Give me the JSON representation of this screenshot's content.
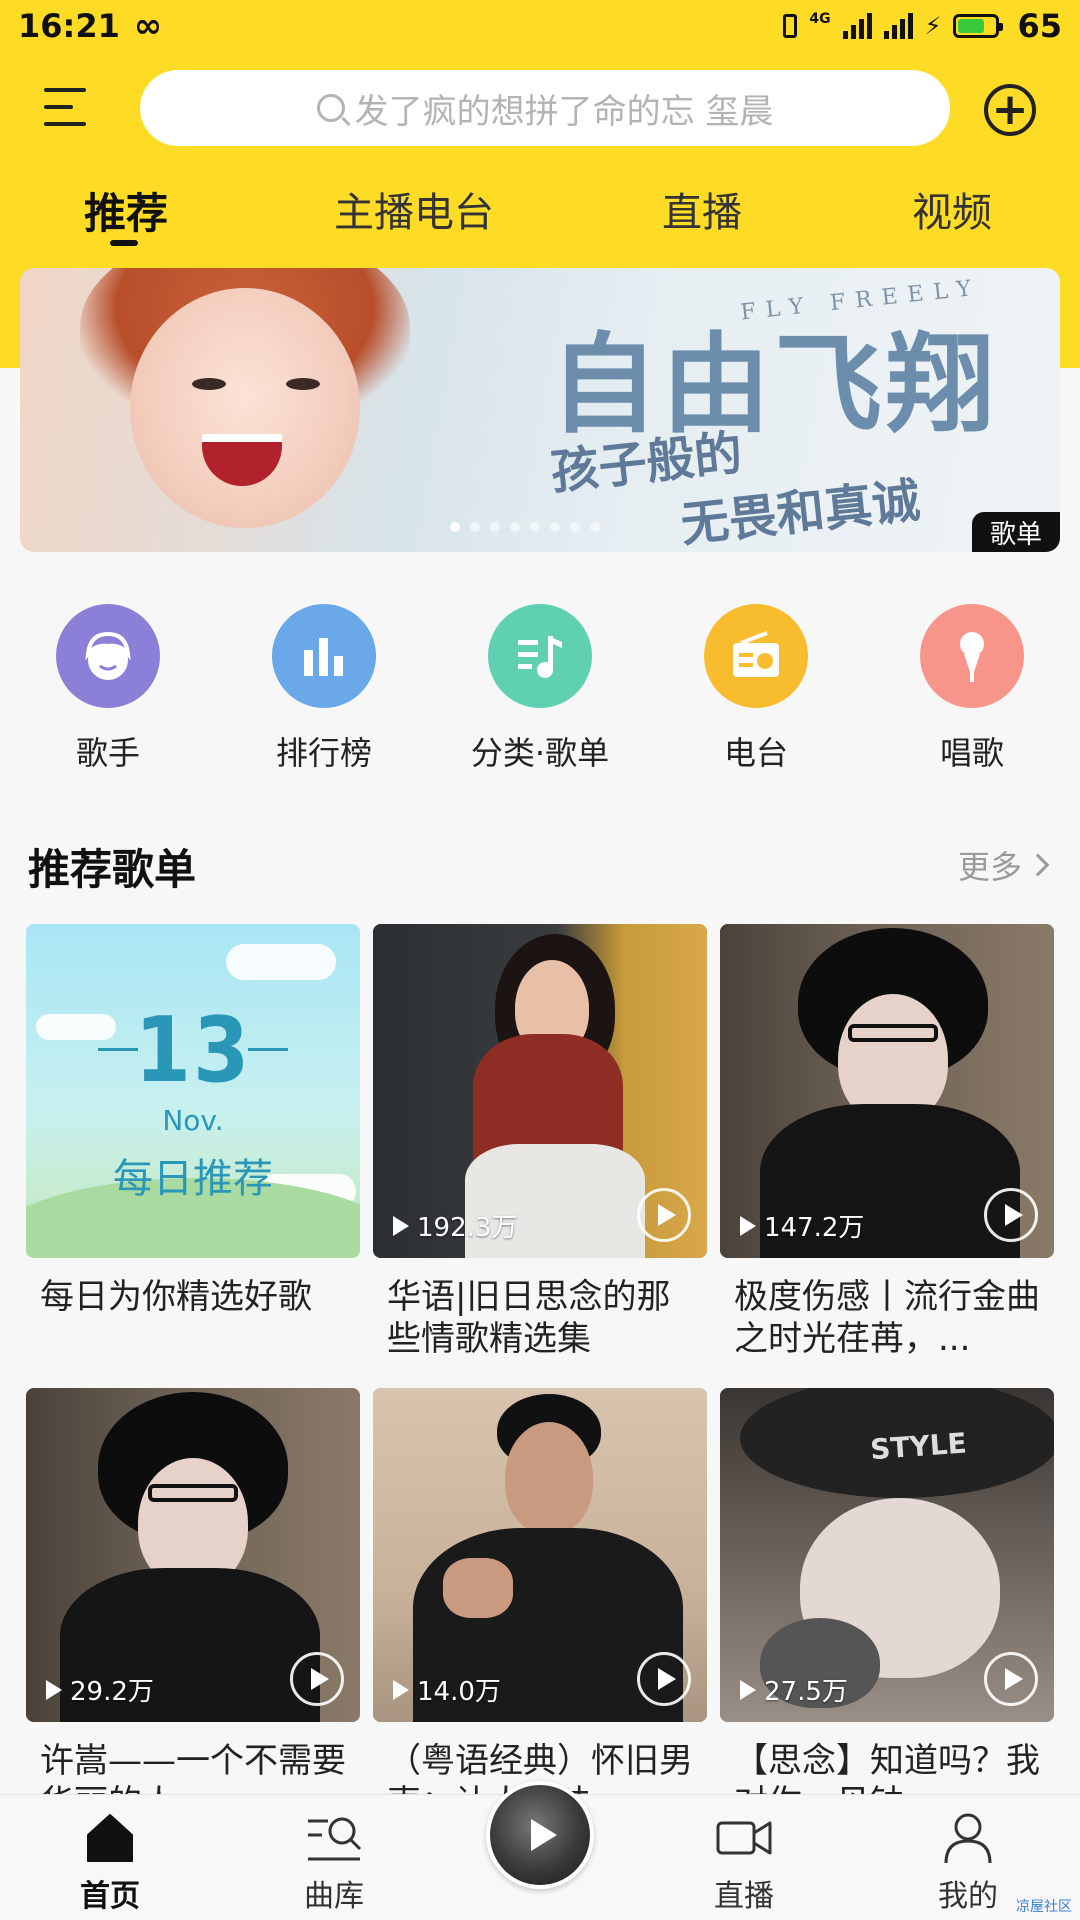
{
  "status_bar": {
    "time": "16:21",
    "network": "4G",
    "battery": "65"
  },
  "header": {
    "search_placeholder": "发了疯的想拼了命的忘  玺晨",
    "menu_icon": "menu-icon",
    "add_icon": "add-circle-icon"
  },
  "tabs": [
    {
      "label": "推荐",
      "active": true
    },
    {
      "label": "主播电台",
      "active": false
    },
    {
      "label": "直播",
      "active": false
    },
    {
      "label": "视频",
      "active": false
    }
  ],
  "banner": {
    "title": "自由飞翔",
    "subtitle_en": "FLY FREELY",
    "line1": "孩子般的",
    "line2": "无畏和真诚",
    "tag": "歌单"
  },
  "quick": [
    {
      "label": "歌手",
      "icon": "singer-icon",
      "color": "#8b80d8"
    },
    {
      "label": "排行榜",
      "icon": "chart-bars-icon",
      "color": "#6aa8ea"
    },
    {
      "label": "分类·歌单",
      "icon": "music-list-icon",
      "color": "#5fd1b1"
    },
    {
      "label": "电台",
      "icon": "radio-icon",
      "color": "#f8bd2e"
    },
    {
      "label": "唱歌",
      "icon": "microphone-icon",
      "color": "#f7958a"
    }
  ],
  "section": {
    "title": "推荐歌单",
    "more": "更多"
  },
  "daily": {
    "day": "13",
    "month": "Nov.",
    "label": "每日推荐"
  },
  "cards": [
    {
      "title": "每日为你精选好歌",
      "count": ""
    },
    {
      "title": "华语|旧日思念的那些情歌精选集",
      "count": "192.3万"
    },
    {
      "title": "极度伤感丨流行金曲之时光荏苒，...",
      "count": "147.2万"
    },
    {
      "title": "许嵩——一个不需要华丽的人",
      "count": "29.2万"
    },
    {
      "title": "（粤语经典）怀旧男声：让人回味",
      "count": "14.0万"
    },
    {
      "title": "【思念】知道吗？我对你一见钟",
      "count": "27.5万"
    }
  ],
  "bottom_nav": [
    {
      "label": "首页",
      "icon": "home-icon",
      "active": true
    },
    {
      "label": "曲库",
      "icon": "library-search-icon",
      "active": false
    },
    {
      "label": "直播",
      "icon": "video-camera-icon",
      "active": false
    },
    {
      "label": "我的",
      "icon": "person-icon",
      "active": false
    }
  ],
  "watermark": "凉屋社区"
}
